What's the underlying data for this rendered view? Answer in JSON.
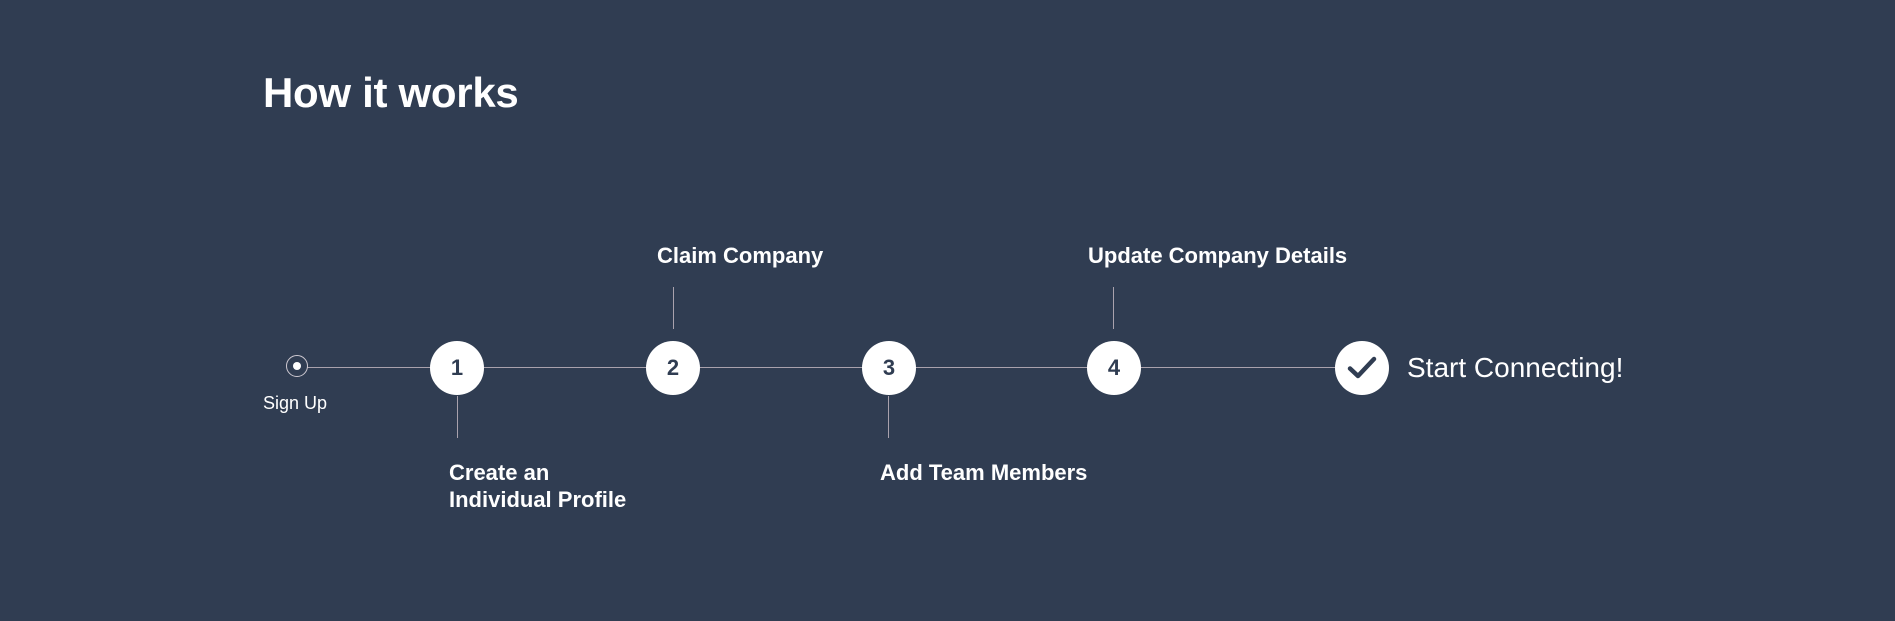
{
  "title": "How it works",
  "start": {
    "label": "Sign Up"
  },
  "steps": [
    {
      "number": "1",
      "label_line1": "Create an",
      "label_line2": "Individual Profile",
      "label_position": "below"
    },
    {
      "number": "2",
      "label": "Claim Company",
      "label_position": "above"
    },
    {
      "number": "3",
      "label": "Add Team Members",
      "label_position": "below"
    },
    {
      "number": "4",
      "label": "Update Company Details",
      "label_position": "above"
    }
  ],
  "finish": {
    "label": "Start Connecting!",
    "icon": "checkmark-icon"
  },
  "colors": {
    "background": "#303d52",
    "circle_fill": "#ffffff",
    "step_number": "#303d52",
    "connector_line": "#a9a2ad"
  }
}
